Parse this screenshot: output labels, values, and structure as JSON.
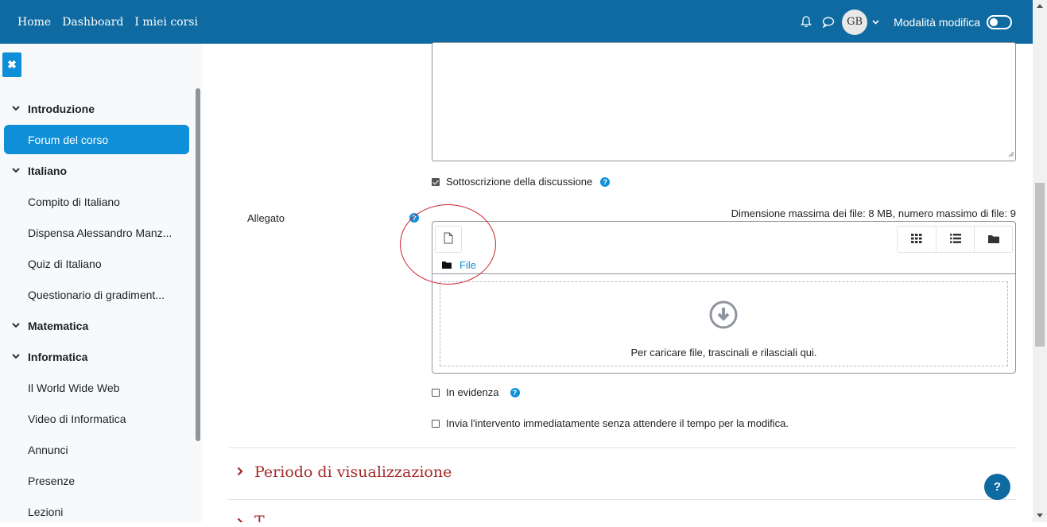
{
  "nav": {
    "links": [
      "Home",
      "Dashboard",
      "I miei corsi"
    ],
    "avatar_initials": "GB",
    "edit_mode_label": "Modalità modifica"
  },
  "drawer": {
    "close_icon": "times-icon",
    "sections": [
      {
        "title": "Introduzione",
        "items": [
          {
            "label": "Forum del corso",
            "active": true
          }
        ]
      },
      {
        "title": "Italiano",
        "items": [
          {
            "label": "Compito di Italiano"
          },
          {
            "label": "Dispensa Alessandro Manz..."
          },
          {
            "label": "Quiz di Italiano"
          },
          {
            "label": "Questionario di gradiment..."
          }
        ]
      },
      {
        "title": "Matematica",
        "items": []
      },
      {
        "title": "Informatica",
        "items": [
          {
            "label": "Il World Wide Web"
          },
          {
            "label": "Video di Informatica"
          },
          {
            "label": "Annunci"
          },
          {
            "label": "Presenze"
          },
          {
            "label": "Lezioni"
          }
        ]
      }
    ]
  },
  "form": {
    "subscribe_label": "Sottoscrizione della discussione",
    "subscribe_checked": true,
    "attachment_label": "Allegato",
    "max_size_text": "Dimensione massima dei file: 8 MB, numero massimo di file: 9",
    "filepicker": {
      "path_label": "File",
      "drop_text": "Per caricare file, trascinali e rilasciali qui."
    },
    "pinned_label": "In evidenza",
    "pinned_checked": false,
    "immediate_label": "Invia l'intervento immediatamente senza attendere il tempo per la modifica.",
    "immediate_checked": false,
    "section_display_period": "Periodo di visualizzazione",
    "section_next": "T"
  },
  "colors": {
    "navbar": "#0f6aa1",
    "accent": "#0f8fd8",
    "section_heading": "#a52a2a",
    "annotation_ellipse": "#c8242b"
  }
}
